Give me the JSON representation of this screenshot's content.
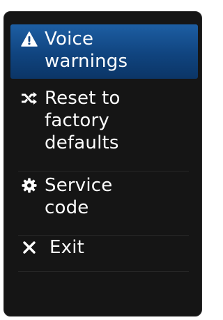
{
  "menu": {
    "items": [
      {
        "icon": "warning-triangle-icon",
        "label": "Voice\nwarnings",
        "selected": true
      },
      {
        "icon": "shuffle-icon",
        "label": "Reset to\nfactory\ndefaults",
        "selected": false
      },
      {
        "icon": "gear-icon",
        "label": "Service\ncode",
        "selected": false
      },
      {
        "icon": "close-icon",
        "label": "Exit",
        "selected": false
      }
    ]
  },
  "colors": {
    "menu_background": "#151515",
    "selected_gradient_top": "#1d5ea3",
    "selected_gradient_bottom": "#0b3566",
    "text": "#ffffff"
  }
}
